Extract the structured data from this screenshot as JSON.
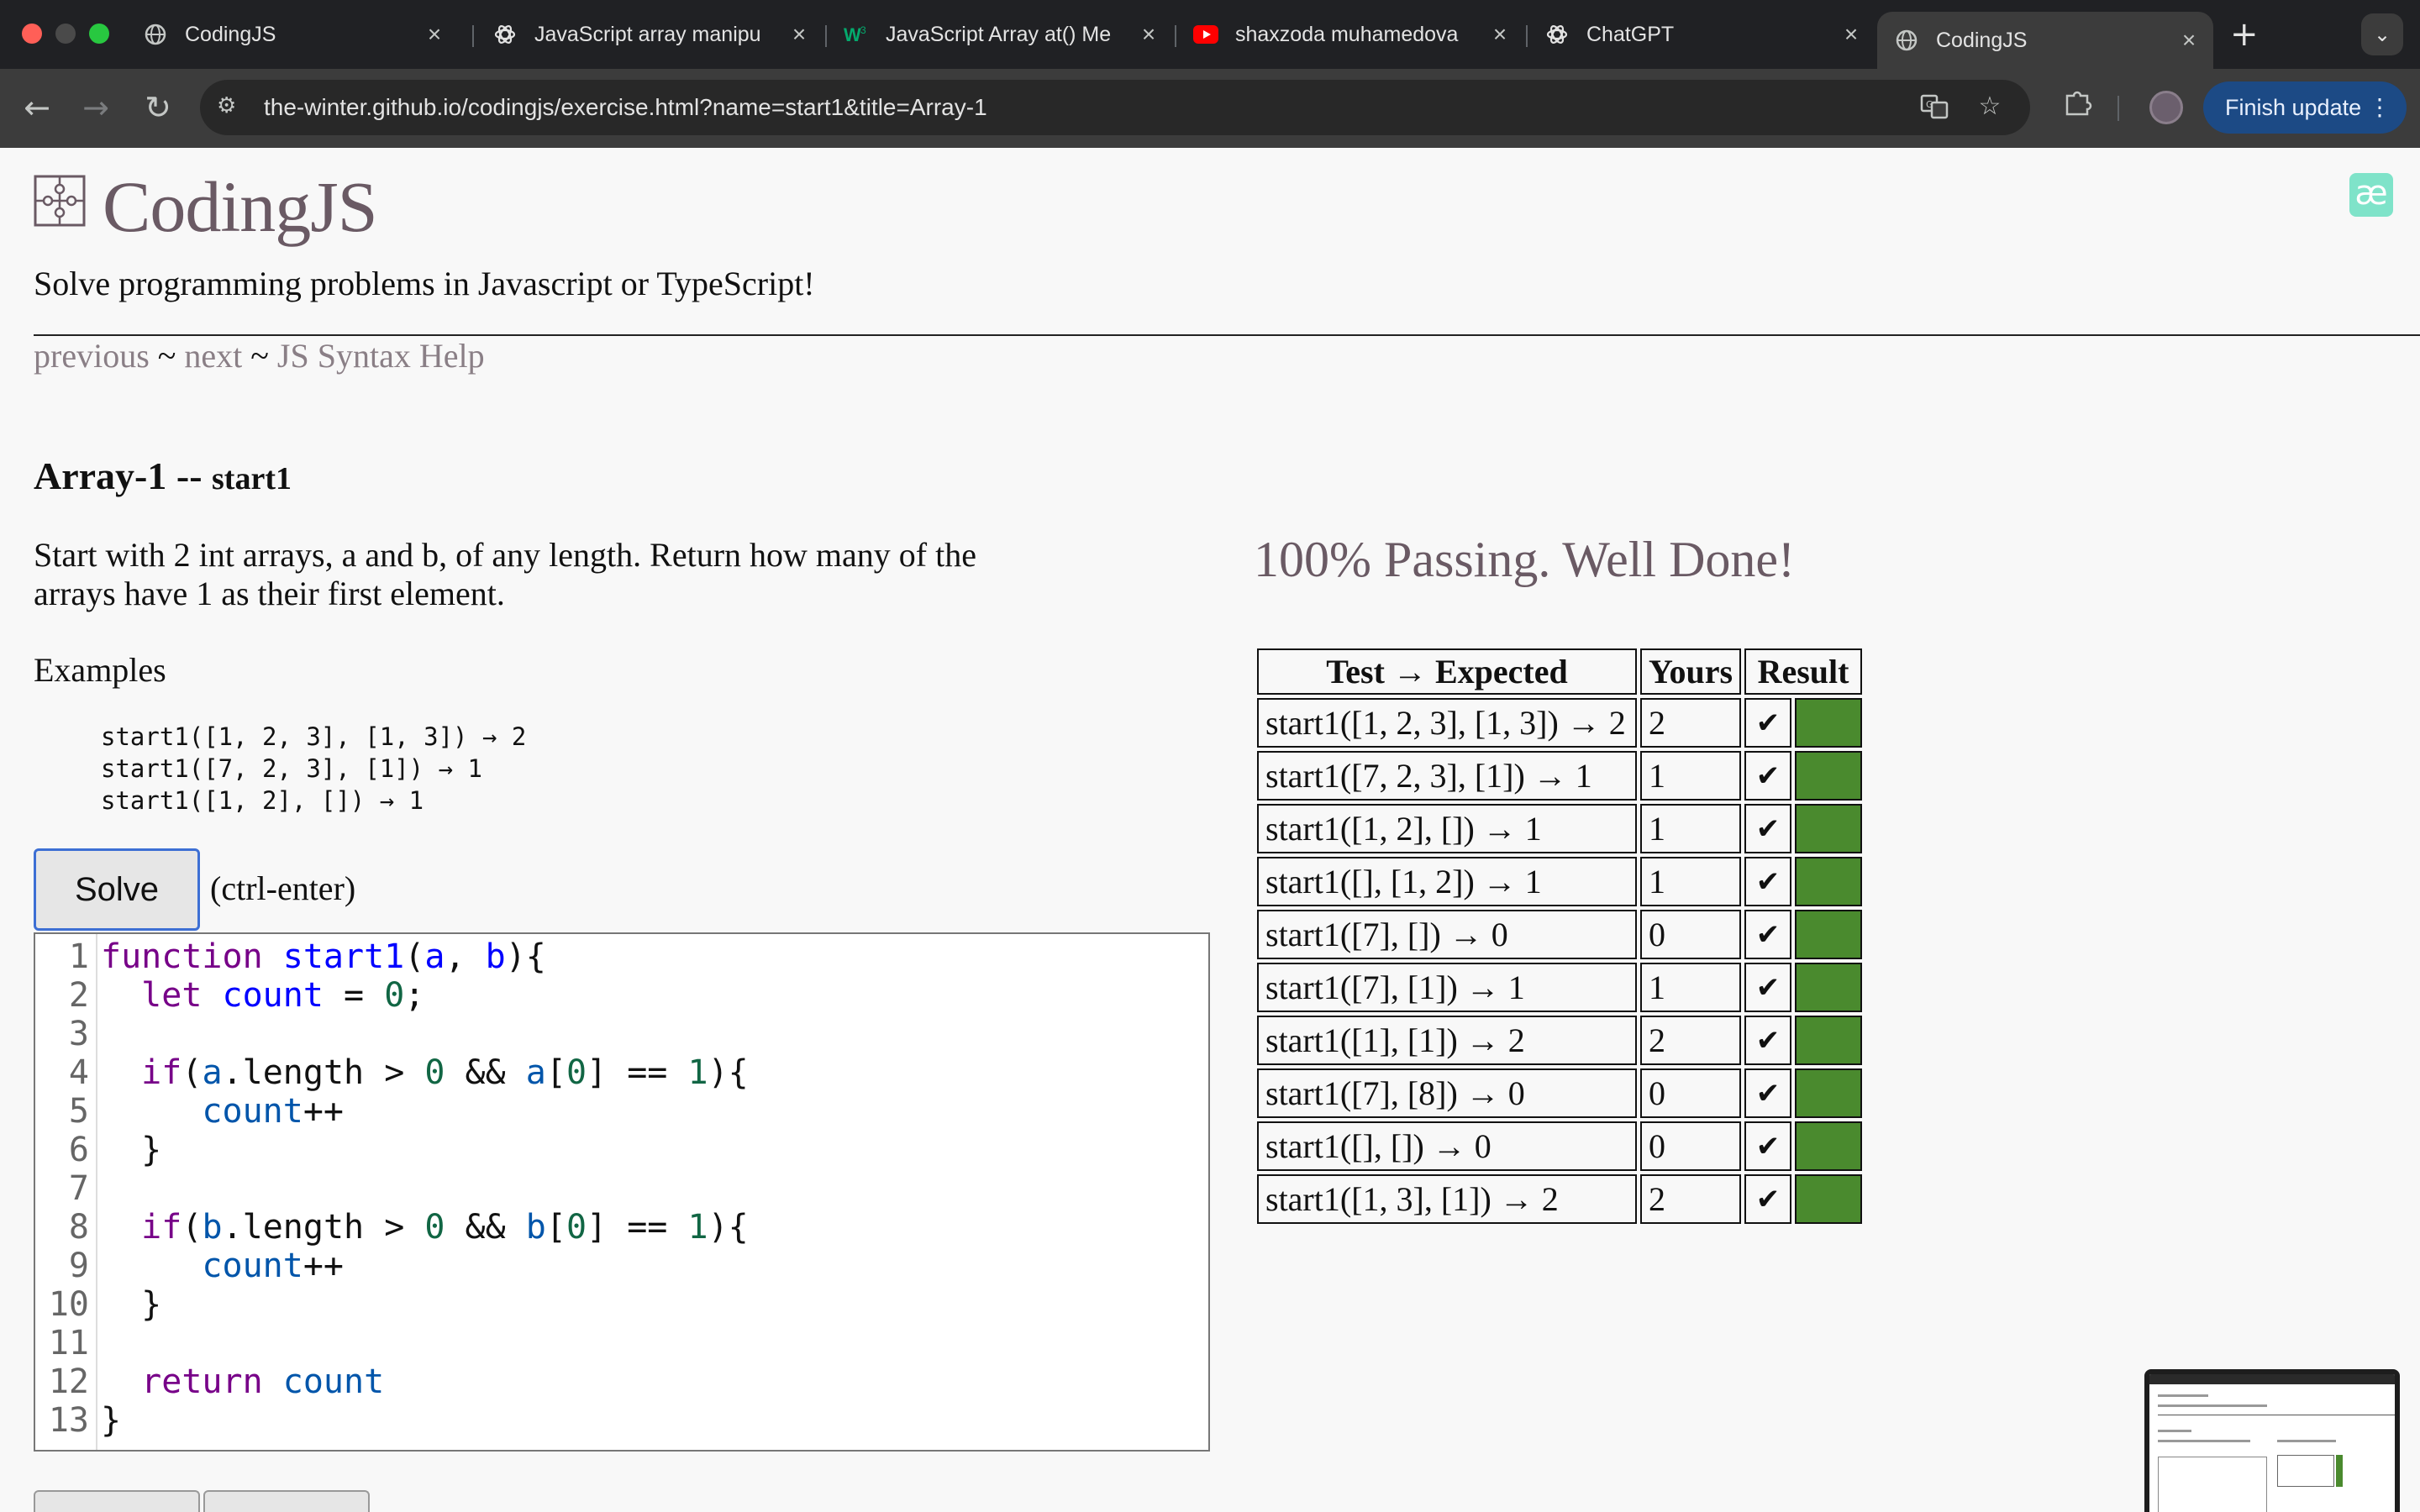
{
  "browser": {
    "tabs": [
      {
        "title": "CodingJS",
        "icon": "globe-icon"
      },
      {
        "title": "JavaScript array manipu",
        "icon": "chatgpt-icon"
      },
      {
        "title": "JavaScript Array at() Me",
        "icon": "w3schools-icon"
      },
      {
        "title": "shaxzoda muhamedova",
        "icon": "youtube-icon"
      },
      {
        "title": "ChatGPT",
        "icon": "chatgpt-icon"
      },
      {
        "title": "CodingJS",
        "icon": "globe-icon",
        "active": true
      }
    ],
    "url": "the-winter.github.io/codingjs/exercise.html?name=start1&title=Array-1",
    "finish_update_label": "Finish update"
  },
  "header": {
    "title": "CodingJS",
    "tagline": "Solve programming problems in Javascript or TypeScript!",
    "nav": {
      "previous": "previous",
      "sep1": " ~ ",
      "next": "next",
      "sep2": " ~ ",
      "help": "JS Syntax Help"
    }
  },
  "exercise": {
    "group": "Array-1",
    "separator": " -- ",
    "name": "start1",
    "description": "Start with 2 int arrays, a and b, of any length. Return how many of the arrays have 1 as their first element.",
    "examples_heading": "Examples",
    "examples": [
      "start1([1, 2, 3], [1, 3]) → 2",
      "start1([7, 2, 3], [1]) → 1",
      "start1([1, 2], []) → 1"
    ],
    "solve_label": "Solve",
    "shortcut_hint": "(ctrl-enter)"
  },
  "editor": {
    "line_numbers": [
      "1",
      "2",
      "3",
      "4",
      "5",
      "6",
      "7",
      "8",
      "9",
      "10",
      "11",
      "12",
      "13"
    ]
  },
  "results": {
    "status": "100% Passing. Well Done!",
    "headers": [
      "Test → Expected",
      "Yours",
      "Result"
    ],
    "check_glyph": "✔",
    "rows": [
      {
        "test": "start1([1, 2, 3], [1, 3]) → 2",
        "yours": "2",
        "pass": true
      },
      {
        "test": "start1([7, 2, 3], [1]) → 1",
        "yours": "1",
        "pass": true
      },
      {
        "test": "start1([1, 2], []) → 1",
        "yours": "1",
        "pass": true
      },
      {
        "test": "start1([], [1, 2]) → 1",
        "yours": "1",
        "pass": true
      },
      {
        "test": "start1([7], []) → 0",
        "yours": "0",
        "pass": true
      },
      {
        "test": "start1([7], [1]) → 1",
        "yours": "1",
        "pass": true
      },
      {
        "test": "start1([1], [1]) → 2",
        "yours": "2",
        "pass": true
      },
      {
        "test": "start1([7], [8]) → 0",
        "yours": "0",
        "pass": true
      },
      {
        "test": "start1([], []) → 0",
        "yours": "0",
        "pass": true
      },
      {
        "test": "start1([1, 3], [1]) → 2",
        "yours": "2",
        "pass": true
      }
    ],
    "pass_color": "#4a8a2e"
  }
}
